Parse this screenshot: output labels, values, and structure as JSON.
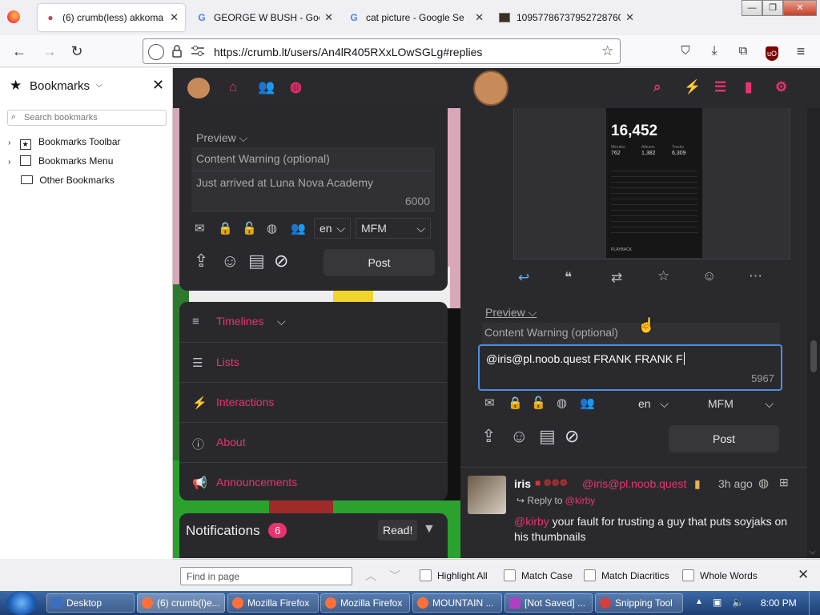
{
  "browser": {
    "tabs": [
      {
        "title": "(6) crumb(less) akkoma",
        "favicon": "cookie-icon",
        "active": true
      },
      {
        "title": "GEORGE W BUSH - Goog",
        "favicon": "google-icon",
        "active": false
      },
      {
        "title": "cat picture - Google Se",
        "favicon": "google-icon",
        "active": false
      },
      {
        "title": "10957786737952728760",
        "favicon": "image-icon",
        "active": false
      }
    ],
    "url": "https://crumb.lt/users/An4lR405RXxLOwSGLg#replies",
    "window_controls": [
      "minimize",
      "restore",
      "close"
    ]
  },
  "bookmarks": {
    "title": "Bookmarks",
    "search_placeholder": "Search bookmarks",
    "items": [
      "Bookmarks Toolbar",
      "Bookmarks Menu",
      "Other Bookmarks"
    ]
  },
  "app": {
    "accent": "#e8336e",
    "left_composer": {
      "preview": "Preview",
      "cw_placeholder": "Content Warning (optional)",
      "text": "Just arrived at Luna Nova Academy",
      "counter": "6000",
      "language": "en",
      "format": "MFM",
      "post": "Post"
    },
    "menu": [
      {
        "label": "Timelines",
        "icon": "hamburger-icon"
      },
      {
        "label": "Lists",
        "icon": "list-icon"
      },
      {
        "label": "Interactions",
        "icon": "bolt-icon"
      },
      {
        "label": "About",
        "icon": "info-icon"
      },
      {
        "label": "Announcements",
        "icon": "megaphone-icon"
      }
    ],
    "notifications": {
      "title": "Notifications",
      "count": "6",
      "read": "Read!"
    },
    "screenshot_card": {
      "big": "16,452",
      "stats_labels": [
        "Minutes",
        "Albums",
        "Tracks"
      ],
      "stats_values": [
        "762",
        "1,382",
        "6,309"
      ],
      "footer": "PLAYBACK"
    },
    "right_composer": {
      "preview": "Preview",
      "cw_placeholder": "Content Warning (optional)",
      "text": "@iris@pl.noob.quest FRANK FRANK F",
      "counter": "5967",
      "language": "en",
      "format": "MFM",
      "post": "Post"
    },
    "reply": {
      "name": "iris",
      "handle": "@iris@pl.noob.quest",
      "time": "3h ago",
      "reply_to_label": "Reply to",
      "reply_to": "@kirby",
      "mention": "@kirby",
      "body": "your fault for trusting a guy that puts soyjaks on his thumbnails"
    }
  },
  "findbar": {
    "placeholder": "Find in page",
    "options": [
      "Highlight All",
      "Match Case",
      "Match Diacritics",
      "Whole Words"
    ]
  },
  "taskbar": {
    "items": [
      "Desktop",
      "(6) crumb(l)e...",
      "Mozilla Firefox",
      "Mozilla Firefox",
      "MOUNTAIN ...",
      "[Not Saved] ...",
      "Snipping Tool"
    ],
    "clock": "8:00 PM"
  }
}
